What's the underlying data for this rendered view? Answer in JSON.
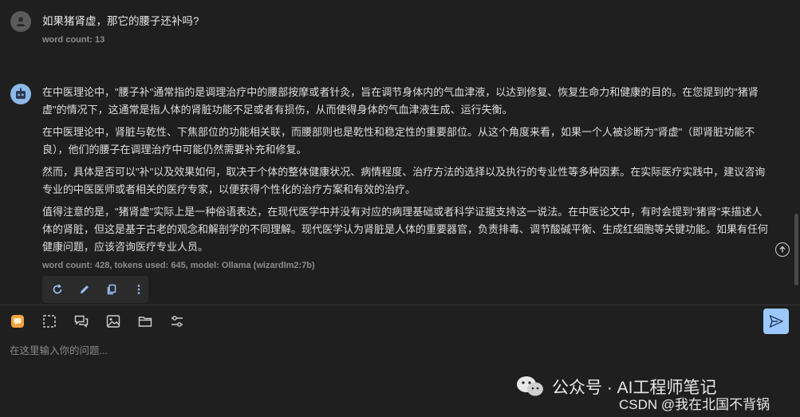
{
  "user_message": {
    "text": "如果猪肾虚，那它的腰子还补吗?",
    "meta": "word count: 13"
  },
  "bot_message": {
    "paragraphs": [
      "在中医理论中，\"腰子补\"通常指的是调理治疗中的腰部按摩或者针灸，旨在调节身体内的气血津液，以达到修复、恢复生命力和健康的目的。在您提到的\"猪肾虚\"的情况下，这通常是指人体的肾脏功能不足或者有损伤，从而使得身体的气血津液生成、运行失衡。",
      "在中医理论中，肾脏与乾性、下焦部位的功能相关联，而腰部则也是乾性和稳定性的重要部位。从这个角度来看，如果一个人被诊断为\"肾虚\"（即肾脏功能不良），他们的腰子在调理治疗中可能仍然需要补充和修复。",
      "然而，具体是否可以\"补\"以及效果如何，取决于个体的整体健康状况、病情程度、治疗方法的选择以及执行的专业性等多种因素。在实际医疗实践中，建议咨询专业的中医医师或者相关的医疗专家，以便获得个性化的治疗方案和有效的治疗。",
      "值得注意的是，\"猪肾虚\"实际上是一种俗语表达，在现代医学中并没有对应的病理基础或者科学证据支持这一说法。在中医论文中，有时会提到\"猪肾\"来描述人体的肾脏，但这是基于古老的观念和解剖学的不同理解。现代医学认为肾脏是人体的重要器官，负责排毒、调节酸碱平衡、生成红细胞等关键功能。如果有任何健康问题，应该咨询医疗专业人员。"
    ],
    "meta": "word count: 428, tokens used: 645, model: Ollama (wizardlm2:7b)"
  },
  "input": {
    "placeholder": "在这里输入你的问题..."
  },
  "watermark": {
    "line1": "公众号 · AI工程师笔记",
    "line2": "CSDN @我在北国不背锅"
  },
  "colors": {
    "background": "#1f1f1f",
    "accent": "#9dc8ff",
    "bot_avatar": "#8cb8e8"
  }
}
